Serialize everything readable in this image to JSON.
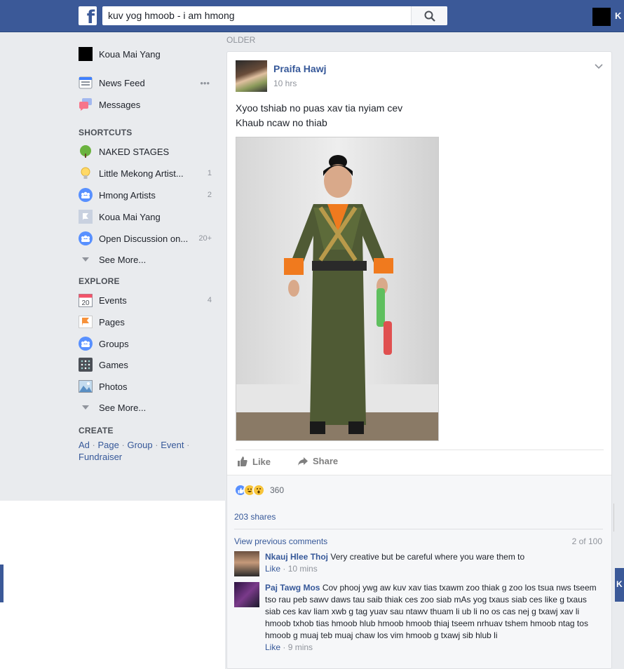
{
  "topbar": {
    "logo_letter": "f",
    "search_value": "kuv yog hmoob - i am hmong",
    "user_initial": "K"
  },
  "leftnav": {
    "profile_name": "Koua Mai Yang",
    "main": [
      {
        "label": "News Feed",
        "icon": "news-feed-icon",
        "more": "•••"
      },
      {
        "label": "Messages",
        "icon": "messages-icon"
      }
    ],
    "shortcuts_heading": "SHORTCUTS",
    "shortcuts": [
      {
        "label": "NAKED STAGES",
        "icon": "tree-icon",
        "count": ""
      },
      {
        "label": "Little Mekong Artist...",
        "icon": "lightbulb-icon",
        "count": "1"
      },
      {
        "label": "Hmong Artists",
        "icon": "group-icon",
        "count": "2"
      },
      {
        "label": "Koua Mai Yang",
        "icon": "page-flag-icon",
        "count": ""
      },
      {
        "label": "Open Discussion on...",
        "icon": "group-icon",
        "count": "20+"
      }
    ],
    "see_more_1": "See More...",
    "explore_heading": "EXPLORE",
    "explore": [
      {
        "label": "Events",
        "icon": "calendar-icon",
        "count": "4",
        "calendar_day": "20"
      },
      {
        "label": "Pages",
        "icon": "flag-icon",
        "count": ""
      },
      {
        "label": "Groups",
        "icon": "group-icon",
        "count": ""
      },
      {
        "label": "Games",
        "icon": "games-icon",
        "count": ""
      },
      {
        "label": "Photos",
        "icon": "photos-icon",
        "count": ""
      }
    ],
    "see_more_2": "See More...",
    "create_heading": "CREATE",
    "create_links": [
      "Ad",
      "Page",
      "Group",
      "Event",
      "Fundraiser"
    ],
    "create_sep": "·"
  },
  "feed": {
    "older_label": "OLDER",
    "post": {
      "author": "Praifa Hawj",
      "time": "10 hrs",
      "text_line1": "Xyoo tshiab no puas xav tia nyiam cev",
      "text_line2": "Khaub ncaw no thiab",
      "like_label": "Like",
      "share_label": "Share",
      "reaction_count": "360",
      "shares": "203 shares",
      "view_previous": "View previous comments",
      "comment_count": "2 of 100",
      "comments": [
        {
          "name": "Nkauj Hlee Thoj",
          "text": "Very creative but be careful where you ware them to",
          "like": "Like",
          "time": "10 mins"
        },
        {
          "name": "Paj Tawg Mos",
          "text": "Cov phooj ywg aw kuv xav tias txawm zoo thiak g zoo los tsua nws tseem tso rau peb sawv daws tau saib thiak ces zoo siab mAs yog txaus siab ces like g txaus siab ces kav liam xwb g tag yuav sau ntawv thuam li ub li no os cas nej g txawj xav li hmoob txhob tias hmoob hlub hmoob hmoob thiaj tseem nrhuav tshem hmoob ntag tos hmoob g muaj teb muaj chaw los vim hmoob g txawj sib hlub li",
          "like": "Like",
          "time": "9 mins"
        }
      ]
    }
  },
  "colors": {
    "brand": "#3b5998",
    "link": "#365899",
    "muted": "#90949c",
    "background": "#e9ebee"
  }
}
